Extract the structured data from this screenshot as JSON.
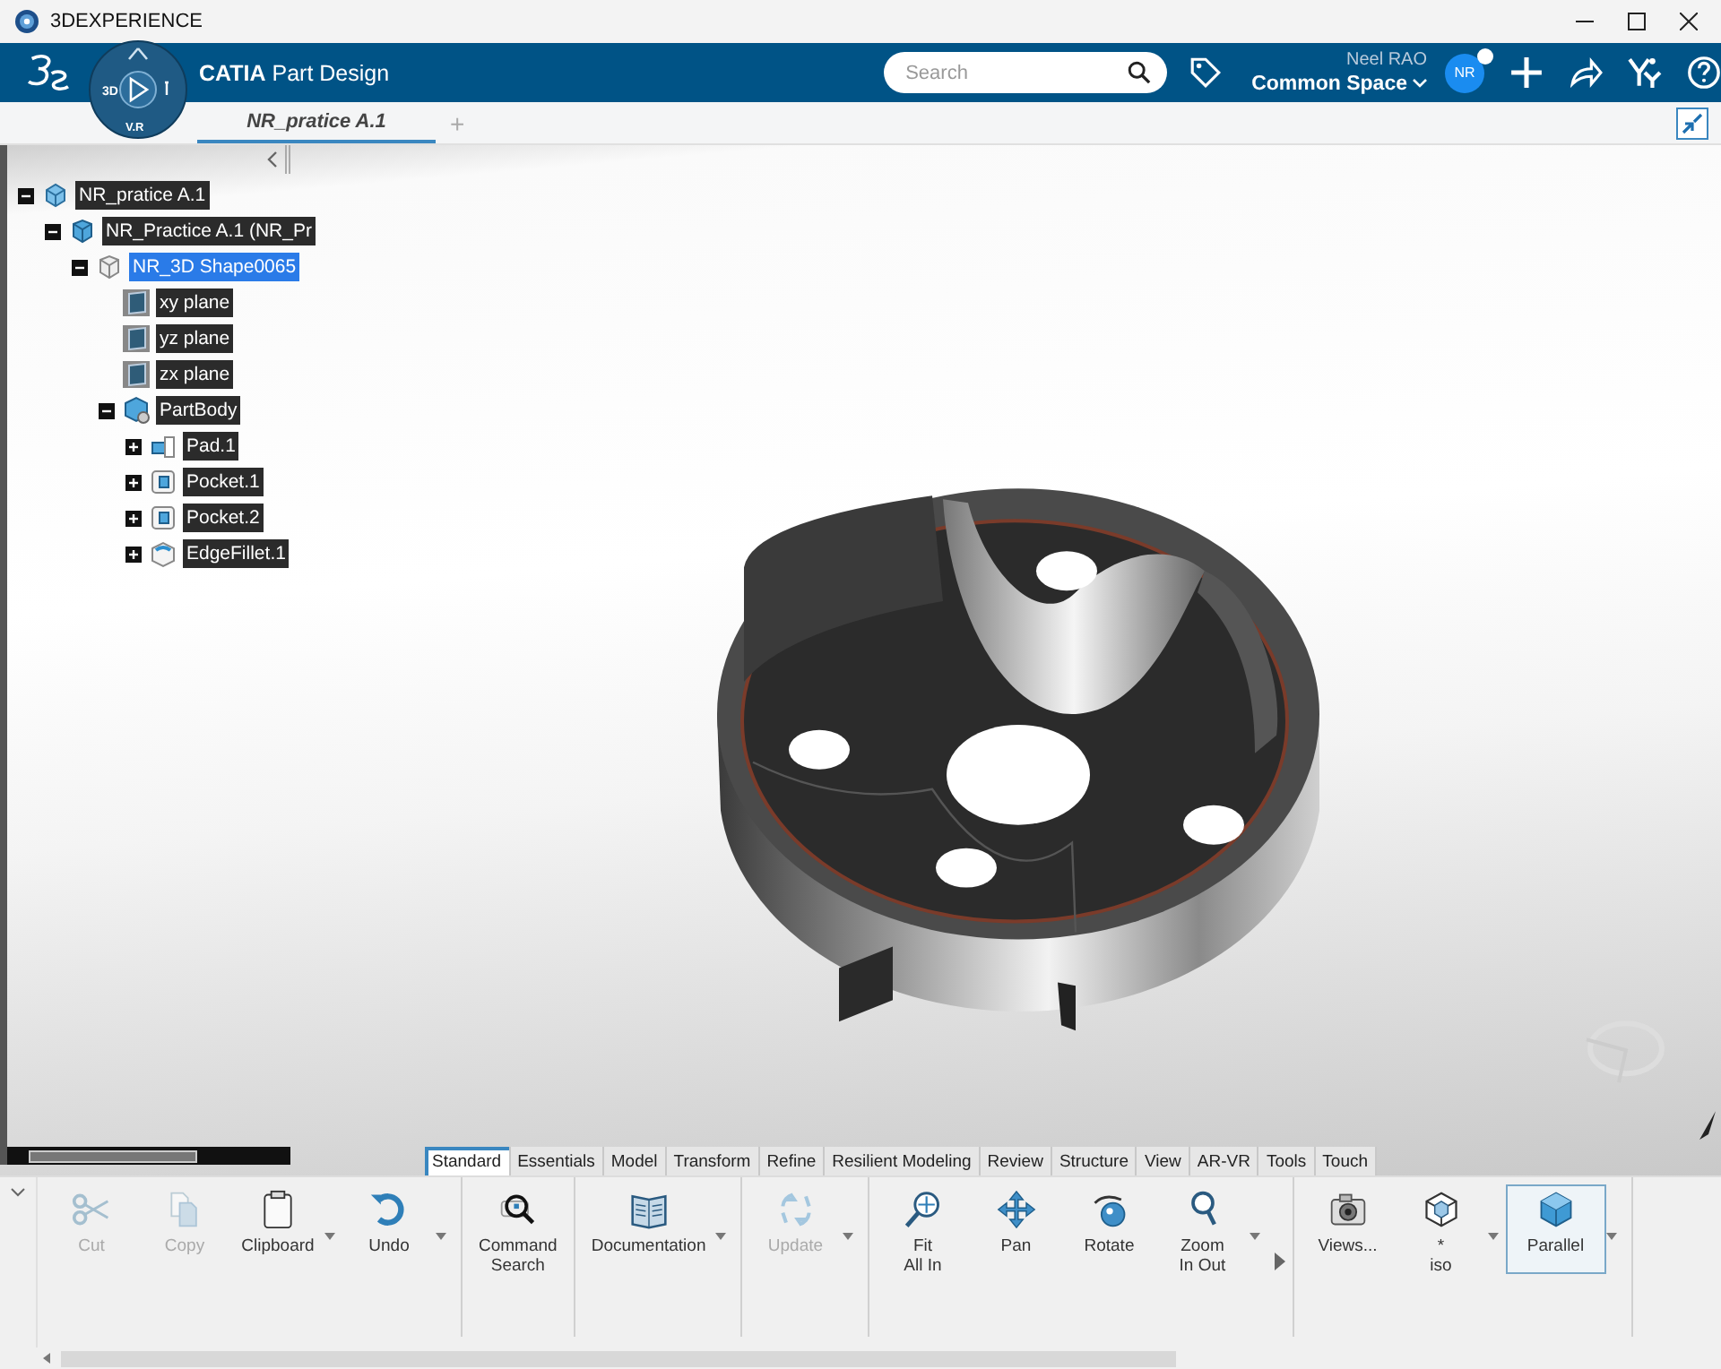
{
  "window": {
    "title": "3DEXPERIENCE"
  },
  "header": {
    "title": "**CATIA** Part Design",
    "compass": {
      "left_label": "3D",
      "bottom_label": "V.R"
    },
    "search": {
      "placeholder": "Search"
    },
    "user": {
      "name": "Neel RAO",
      "space": "Common Space",
      "initials": "NR",
      "online": true
    }
  },
  "tabs": [
    {
      "label": "NR_pratice A.1",
      "selected": true
    }
  ],
  "add_tab": "+",
  "tree": {
    "items": [
      {
        "label": "NR_pratice A.1",
        "kind": "product",
        "expanded": true,
        "selected": false,
        "children": [
          {
            "label": "NR_Practice A.1 (NR_Pr",
            "kind": "part",
            "expanded": true,
            "selected": false,
            "children": [
              {
                "label": "NR_3D Shape0065",
                "kind": "shape",
                "expanded": true,
                "selected": true,
                "children": [
                  {
                    "label": "xy plane",
                    "kind": "plane",
                    "selected": false
                  },
                  {
                    "label": "yz plane",
                    "kind": "plane",
                    "selected": false
                  },
                  {
                    "label": "zx plane",
                    "kind": "plane",
                    "selected": false
                  },
                  {
                    "label": "PartBody",
                    "kind": "body",
                    "expanded": true,
                    "selected": false,
                    "children": [
                      {
                        "label": "Pad.1",
                        "kind": "pad",
                        "expanded": false,
                        "selected": false
                      },
                      {
                        "label": "Pocket.1",
                        "kind": "pocket",
                        "expanded": false,
                        "selected": false
                      },
                      {
                        "label": "Pocket.2",
                        "kind": "pocket",
                        "expanded": false,
                        "selected": false
                      },
                      {
                        "label": "EdgeFillet.1",
                        "kind": "fillet",
                        "expanded": false,
                        "selected": false
                      }
                    ]
                  }
                ]
              }
            ]
          }
        ]
      }
    ]
  },
  "ribbon": {
    "tabs": [
      {
        "label": "Standard",
        "selected": true
      },
      {
        "label": "Essentials",
        "selected": false
      },
      {
        "label": "Model",
        "selected": false
      },
      {
        "label": "Transform",
        "selected": false
      },
      {
        "label": "Refine",
        "selected": false
      },
      {
        "label": "Resilient Modeling",
        "selected": false
      },
      {
        "label": "Review",
        "selected": false
      },
      {
        "label": "Structure",
        "selected": false
      },
      {
        "label": "View",
        "selected": false
      },
      {
        "label": "AR-VR",
        "selected": false
      },
      {
        "label": "Tools",
        "selected": false
      },
      {
        "label": "Touch",
        "selected": false
      }
    ],
    "groups": [
      {
        "commands": [
          {
            "label": [
              "Cut"
            ],
            "kind": "cut",
            "disabled": true,
            "dropdown": false,
            "selected": false
          },
          {
            "label": [
              "Copy"
            ],
            "kind": "copy",
            "disabled": true,
            "dropdown": false,
            "selected": false
          },
          {
            "label": [
              "Clipboard"
            ],
            "kind": "clipboard",
            "disabled": false,
            "dropdown": true,
            "selected": false
          },
          {
            "label": [
              "Undo"
            ],
            "kind": "undo",
            "disabled": false,
            "dropdown": true,
            "selected": false
          }
        ]
      },
      {
        "commands": [
          {
            "label": [
              "Command",
              "Search"
            ],
            "kind": "finder",
            "disabled": false,
            "dropdown": false,
            "selected": false
          }
        ]
      },
      {
        "commands": [
          {
            "label": [
              "Documentation"
            ],
            "kind": "book",
            "disabled": false,
            "dropdown": true,
            "selected": false
          }
        ]
      },
      {
        "commands": [
          {
            "label": [
              "Update"
            ],
            "kind": "update",
            "disabled": true,
            "dropdown": true,
            "selected": false
          }
        ]
      },
      {
        "more": true,
        "commands": [
          {
            "label": [
              "Fit",
              "All In"
            ],
            "kind": "fit",
            "disabled": false,
            "dropdown": false,
            "selected": false
          },
          {
            "label": [
              "Pan"
            ],
            "kind": "pan",
            "disabled": false,
            "dropdown": false,
            "selected": false
          },
          {
            "label": [
              "Rotate"
            ],
            "kind": "rotate",
            "disabled": false,
            "dropdown": false,
            "selected": false
          },
          {
            "label": [
              "Zoom",
              "In Out"
            ],
            "kind": "zoom",
            "disabled": false,
            "dropdown": true,
            "selected": false
          }
        ]
      },
      {
        "commands": [
          {
            "label": [
              "Views..."
            ],
            "kind": "camera",
            "disabled": false,
            "dropdown": false,
            "selected": false
          },
          {
            "label": [
              "*",
              "iso"
            ],
            "kind": "wirecube",
            "disabled": false,
            "dropdown": true,
            "selected": false
          },
          {
            "label": [
              "Parallel"
            ],
            "kind": "cube",
            "disabled": false,
            "dropdown": true,
            "selected": true
          }
        ]
      }
    ]
  }
}
